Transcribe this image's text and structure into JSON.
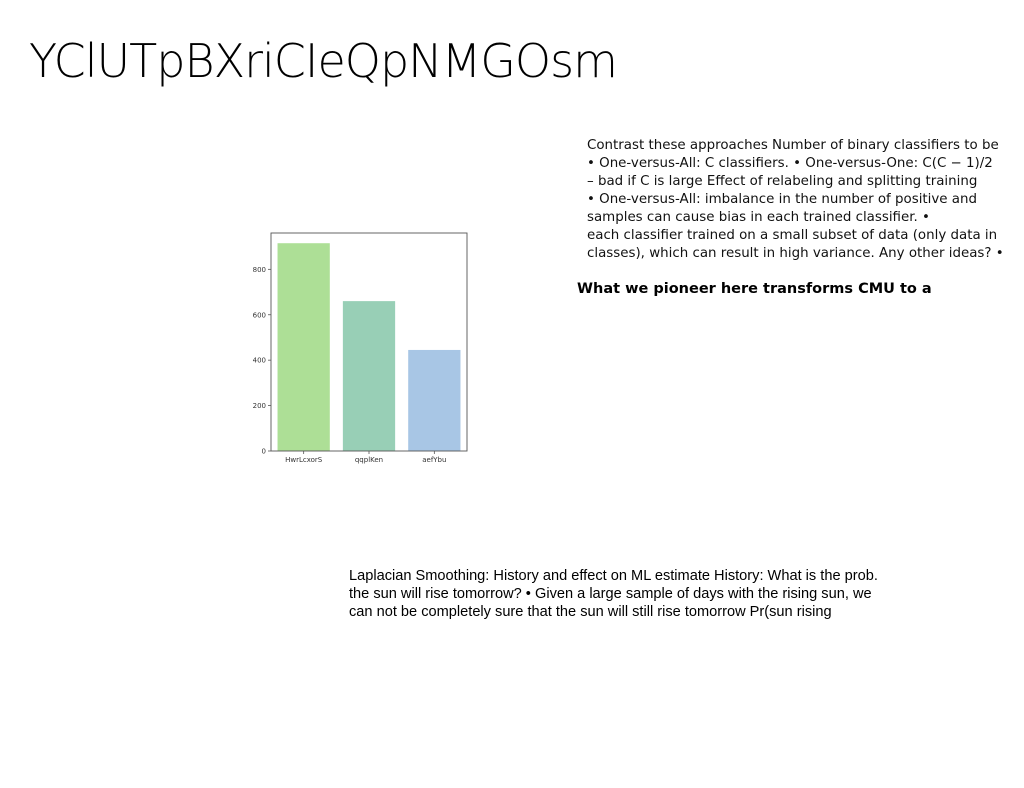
{
  "slide": {
    "title": "YClUTpBXriCIeQpNMGOsm",
    "right_text_lines": [
      "Contrast these approaches Number of binary classifiers to be",
      "• One-versus-All: C classifiers. • One-versus-One: C(C − 1)/2",
      "– bad if C is large Effect of relabeling and splitting training",
      "• One-versus-All: imbalance in the number of positive and",
      "samples can cause bias in each trained classifier. •",
      "each classifier trained on a small subset of data (only data in",
      "classes), which can result in high variance. Any other ideas? •"
    ],
    "tagline": "What we pioneer here transforms CMU to a",
    "bottom_text_lines": [
      "Laplacian Smoothing: History and effect on ML estimate History: What is the prob.",
      "the sun will rise tomorrow? • Given a large sample of days with the rising sun, we",
      "can not be completely sure that the sun will still rise tomorrow Pr(sun rising"
    ]
  },
  "colors": {
    "bar_1": "#addf96",
    "bar_2": "#98cfb6",
    "bar_3": "#a8c6e5",
    "axis": "#555555"
  },
  "chart_data": {
    "type": "bar",
    "categories": [
      "HwrLcxorS",
      "qqplKen",
      "aefYbu"
    ],
    "values": [
      915,
      660,
      445
    ],
    "ylim": [
      0,
      960
    ],
    "yticks": [
      0,
      200,
      400,
      600,
      800
    ],
    "title": "",
    "xlabel": "",
    "ylabel": "",
    "grid": false
  }
}
